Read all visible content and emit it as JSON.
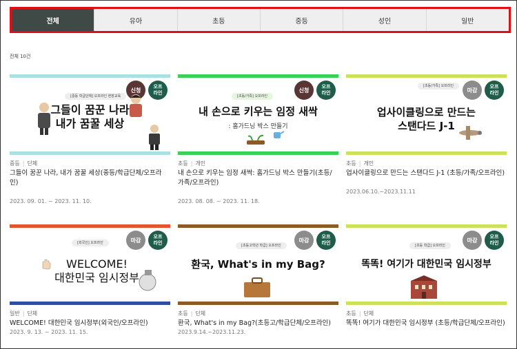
{
  "tabs": [
    "전체",
    "유아",
    "초등",
    "중등",
    "성인",
    "일반"
  ],
  "count_text": "전체 10건",
  "cards": [
    {
      "pill": "[중등 학급단체] 오프라인 현장교육",
      "badge": "신청",
      "mode": "오프\n라인",
      "headline": [
        "그들이 꿈꾼 나라",
        "내가 꿈꿀 세상"
      ],
      "sub": "",
      "category": "중등",
      "group": "단체",
      "title": "그들이 꿈꾼 나라, 내가 꿈꿀 세상(중등/학급단체/오프라인)",
      "date": "2023. 09. 01. ~ 2023. 11. 10.",
      "colors": {
        "top": "#a8e0e4",
        "bottom": "#a8e0e4",
        "badge": "#5a3535"
      }
    },
    {
      "pill": "[초등/가족] 오프라인",
      "badge": "신청",
      "mode": "오프\n라인",
      "headline": [
        "내 손으로 키우는 임정 새싹"
      ],
      "sub": ": 홈가드닝 박스 만들기",
      "category": "초등",
      "group": "개인",
      "title": "내 손으로 키우는 임정 새싹: 홈가드닝 박스 만들기(초등/가족/오프라인)",
      "date": "2023. 08. 08. ~ 2023. 11. 18.",
      "colors": {
        "top": "#37d15a",
        "bottom": "#37d15a",
        "badge": "#5a3535"
      }
    },
    {
      "pill": "[초등/가족] 오프라인",
      "badge": "마감",
      "mode": "오프\n라인",
      "headline": [
        "업사이클링으로 만드는",
        "스탠다드 J-1"
      ],
      "sub": "",
      "category": "초등",
      "group": "개인",
      "title": "업사이클링으로 만드는 스탠다드 J-1 (초등/가족/오프라인)",
      "date": "2023.06.10.~2023.11.11",
      "colors": {
        "top": "#cde25a",
        "bottom": "#cde25a",
        "badge": "#8c8c8c"
      }
    },
    {
      "pill": "[외국인] 오프라인",
      "badge": "마감",
      "mode": "오프\n라인",
      "headline": [
        "WELCOME!",
        "대한민국 임시정부"
      ],
      "sub": "",
      "category": "일반",
      "group": "단체",
      "title": "WELCOME! 대한민국 임시정부(외국인/오프라인)",
      "date": "2023. 9. 13. ~ 2023. 11. 15.",
      "colors": {
        "top": "#e0562e",
        "bottom": "#2e4fa0",
        "badge": "#8c8c8c"
      }
    },
    {
      "pill": "[초등고학년 학급] 오프라인",
      "badge": "마감",
      "mode": "오프\n라인",
      "headline": [
        "환국, What's in my Bag?"
      ],
      "sub": "",
      "category": "초등",
      "group": "단체",
      "title": "환국, What's in my Bag?(초등고/학급단체/오프라인)",
      "date": "2023.9.14.~2023.11.23.",
      "colors": {
        "top": "#8a5a28",
        "bottom": "#8a5a28",
        "badge": "#8c8c8c"
      }
    },
    {
      "pill": "[초등 학급] 오프라인",
      "badge": "마감",
      "mode": "오프\n라인",
      "headline": [
        "똑똑! 여기가 대한민국 임시정부"
      ],
      "sub": "",
      "category": "초등",
      "group": "단체",
      "title": "똑똑! 여기가 대한민국 임시정부 (초등/학급단체/오프라인)",
      "date": "",
      "colors": {
        "top": "#cde25a",
        "bottom": "#cde25a",
        "badge": "#8c8c8c"
      }
    }
  ]
}
